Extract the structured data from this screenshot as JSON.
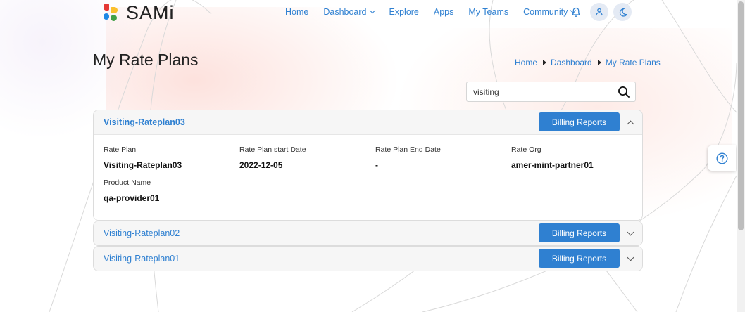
{
  "app": {
    "logo_text": "SAMi"
  },
  "nav": {
    "items": [
      {
        "label": "Home"
      },
      {
        "label": "Dashboard",
        "dropdown": true
      },
      {
        "label": "Explore"
      },
      {
        "label": "Apps"
      },
      {
        "label": "My Teams"
      },
      {
        "label": "Community",
        "dropdown": true
      }
    ],
    "icons": [
      "bell-icon",
      "user-icon",
      "moon-icon"
    ]
  },
  "page": {
    "title": "My Rate Plans",
    "breadcrumb": [
      "Home",
      "Dashboard",
      "My Rate Plans"
    ]
  },
  "search": {
    "value": "visiting",
    "placeholder": ""
  },
  "plans": [
    {
      "name": "Visiting-Rateplan03",
      "expanded": true,
      "billing_label": "Billing Reports",
      "fields": [
        {
          "label": "Rate Plan",
          "value": "Visiting-Rateplan03"
        },
        {
          "label": "Rate Plan start Date",
          "value": "2022-12-05"
        },
        {
          "label": "Rate Plan End Date",
          "value": "-"
        },
        {
          "label": "Rate Org",
          "value": "amer-mint-partner01"
        },
        {
          "label": "Product Name",
          "value": "qa-provider01"
        }
      ]
    },
    {
      "name": "Visiting-Rateplan02",
      "expanded": false,
      "billing_label": "Billing Reports"
    },
    {
      "name": "Visiting-Rateplan01",
      "expanded": false,
      "billing_label": "Billing Reports"
    }
  ],
  "colors": {
    "accent": "#2f80d1",
    "header_bg": "#f6f6f6"
  }
}
